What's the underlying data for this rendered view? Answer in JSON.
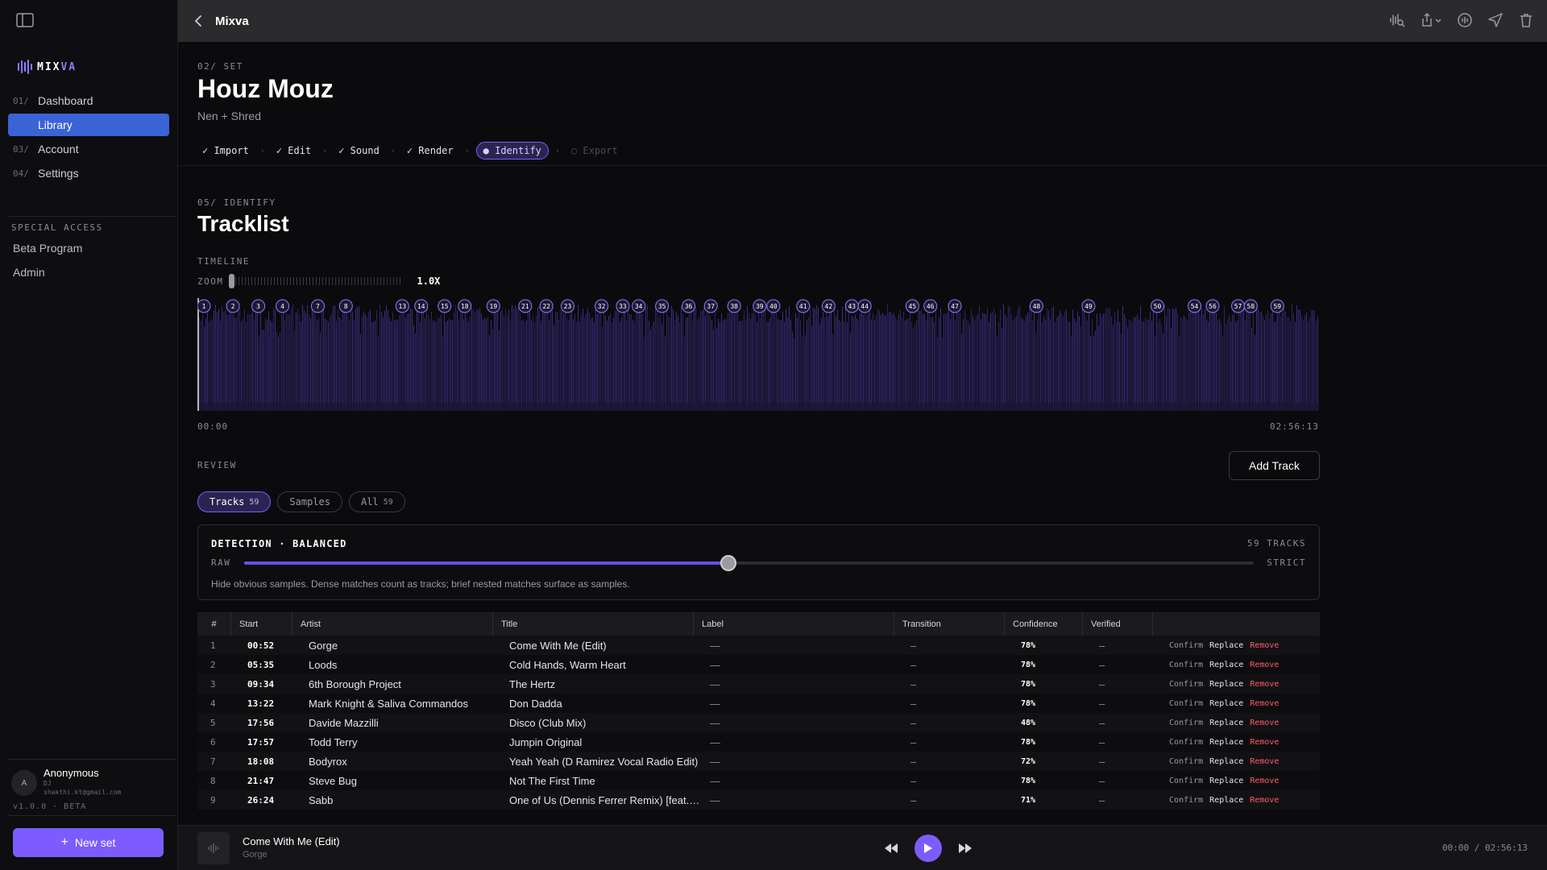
{
  "app": {
    "title": "Mixva",
    "logo_left": "MIX",
    "logo_right": "VA"
  },
  "sidebar": {
    "nav": [
      {
        "num": "01/",
        "label": "Dashboard"
      },
      {
        "num": "02/",
        "label": "Library",
        "active": true
      },
      {
        "num": "03/",
        "label": "Account"
      },
      {
        "num": "04/",
        "label": "Settings"
      }
    ],
    "special_title": "SPECIAL ACCESS",
    "special_links": [
      "Beta Program",
      "Admin"
    ],
    "user": {
      "name": "Anonymous",
      "initial": "A",
      "role": "DJ",
      "email": "shakthi.kt@gmail.com"
    },
    "version": "v1.0.0 · BETA",
    "new_set": "New set"
  },
  "set": {
    "eyebrow": "02/ SET",
    "title": "Houz Mouz",
    "subtitle": "Nen + Shred",
    "steps": [
      {
        "label": "✓ Import",
        "state": "done"
      },
      {
        "label": "✓ Edit",
        "state": "done"
      },
      {
        "label": "✓ Sound",
        "state": "done"
      },
      {
        "label": "✓ Render",
        "state": "done"
      },
      {
        "label": "● Identify",
        "state": "active"
      },
      {
        "label": "○ Export",
        "state": "disabled"
      }
    ]
  },
  "identify": {
    "eyebrow": "05/ IDENTIFY",
    "title": "Tracklist",
    "timeline_label": "TIMELINE",
    "zoom_label": "ZOOM",
    "zoom_value": "1.0X",
    "time_start": "00:00",
    "time_end": "02:56:13",
    "duration_seconds": 10573,
    "track_markers": [
      {
        "n": "1",
        "t": 52
      },
      {
        "n": "2",
        "t": 335
      },
      {
        "n": "3",
        "t": 574
      },
      {
        "n": "4",
        "t": 802
      },
      {
        "n": "7",
        "t": 1135
      },
      {
        "n": "8",
        "t": 1400
      },
      {
        "n": "13",
        "t": 1932
      },
      {
        "n": "14",
        "t": 2110
      },
      {
        "n": "15",
        "t": 2330
      },
      {
        "n": "18",
        "t": 2520
      },
      {
        "n": "19",
        "t": 2790
      },
      {
        "n": "21",
        "t": 3090
      },
      {
        "n": "22",
        "t": 3290
      },
      {
        "n": "23",
        "t": 3490
      },
      {
        "n": "32",
        "t": 3810
      },
      {
        "n": "33",
        "t": 4010
      },
      {
        "n": "34",
        "t": 4160
      },
      {
        "n": "35",
        "t": 4380
      },
      {
        "n": "36",
        "t": 4630
      },
      {
        "n": "37",
        "t": 4840
      },
      {
        "n": "38",
        "t": 5060
      },
      {
        "n": "39",
        "t": 5300
      },
      {
        "n": "40",
        "t": 5430
      },
      {
        "n": "41",
        "t": 5710
      },
      {
        "n": "42",
        "t": 5950
      },
      {
        "n": "43",
        "t": 6170
      },
      {
        "n": "44",
        "t": 6290
      },
      {
        "n": "45",
        "t": 6740
      },
      {
        "n": "46",
        "t": 6910
      },
      {
        "n": "47",
        "t": 7140
      },
      {
        "n": "48",
        "t": 7910
      },
      {
        "n": "49",
        "t": 8400
      },
      {
        "n": "50",
        "t": 9050
      },
      {
        "n": "54",
        "t": 9400
      },
      {
        "n": "56",
        "t": 9570
      },
      {
        "n": "57",
        "t": 9810
      },
      {
        "n": "58",
        "t": 9930
      },
      {
        "n": "59",
        "t": 10180
      }
    ],
    "review_label": "REVIEW",
    "add_track": "Add Track",
    "filters": [
      {
        "label": "Tracks",
        "count": "59",
        "active": true
      },
      {
        "label": "Samples",
        "count": ""
      },
      {
        "label": "All",
        "count": "59"
      }
    ],
    "detection": {
      "title": "DETECTION · BALANCED",
      "count": "59 TRACKS",
      "raw": "RAW",
      "strict": "STRICT",
      "level": 0.48,
      "description": "Hide obvious samples. Dense matches count as tracks; brief nested matches surface as samples."
    },
    "columns": [
      "#",
      "Start",
      "Artist",
      "Title",
      "Label",
      "Transition",
      "Confidence",
      "Verified"
    ],
    "actions": {
      "confirm": "Confirm",
      "replace": "Replace",
      "remove": "Remove"
    },
    "rows": [
      {
        "num": "1",
        "start": "00:52",
        "artist": "Gorge",
        "title": "Come With Me (Edit)",
        "label": "—",
        "transition": "–",
        "confidence": "78%",
        "verified": "–"
      },
      {
        "num": "2",
        "start": "05:35",
        "artist": "Loods",
        "title": "Cold Hands, Warm Heart",
        "label": "—",
        "transition": "–",
        "confidence": "78%",
        "verified": "–"
      },
      {
        "num": "3",
        "start": "09:34",
        "artist": "6th Borough Project",
        "title": "The Hertz",
        "label": "—",
        "transition": "–",
        "confidence": "78%",
        "verified": "–"
      },
      {
        "num": "4",
        "start": "13:22",
        "artist": "Mark Knight & Saliva Commandos",
        "title": "Don Dadda",
        "label": "—",
        "transition": "–",
        "confidence": "78%",
        "verified": "–"
      },
      {
        "num": "5",
        "start": "17:56",
        "artist": "Davide Mazzilli",
        "title": "Disco (Club Mix)",
        "label": "—",
        "transition": "–",
        "confidence": "48%",
        "verified": "–"
      },
      {
        "num": "6",
        "start": "17:57",
        "artist": "Todd Terry",
        "title": "Jumpin Original",
        "label": "—",
        "transition": "–",
        "confidence": "78%",
        "verified": "–"
      },
      {
        "num": "7",
        "start": "18:08",
        "artist": "Bodyrox",
        "title": "Yeah Yeah (D Ramirez Vocal Radio Edit)",
        "label": "—",
        "transition": "–",
        "confidence": "72%",
        "verified": "–"
      },
      {
        "num": "8",
        "start": "21:47",
        "artist": "Steve Bug",
        "title": "Not The First Time",
        "label": "—",
        "transition": "–",
        "confidence": "78%",
        "verified": "–"
      },
      {
        "num": "9",
        "start": "26:24",
        "artist": "Sabb",
        "title": "One of Us (Dennis Ferrer Remix) [feat. ...]",
        "label": "—",
        "transition": "–",
        "confidence": "71%",
        "verified": "–"
      }
    ]
  },
  "player": {
    "title": "Come With Me (Edit)",
    "artist": "Gorge",
    "time": "00:00 / 02:56:13"
  },
  "colors": {
    "accent": "#7c5cff",
    "active_nav": "#3a63d6",
    "remove": "#ff5c66",
    "wave": "#3b2f86"
  }
}
